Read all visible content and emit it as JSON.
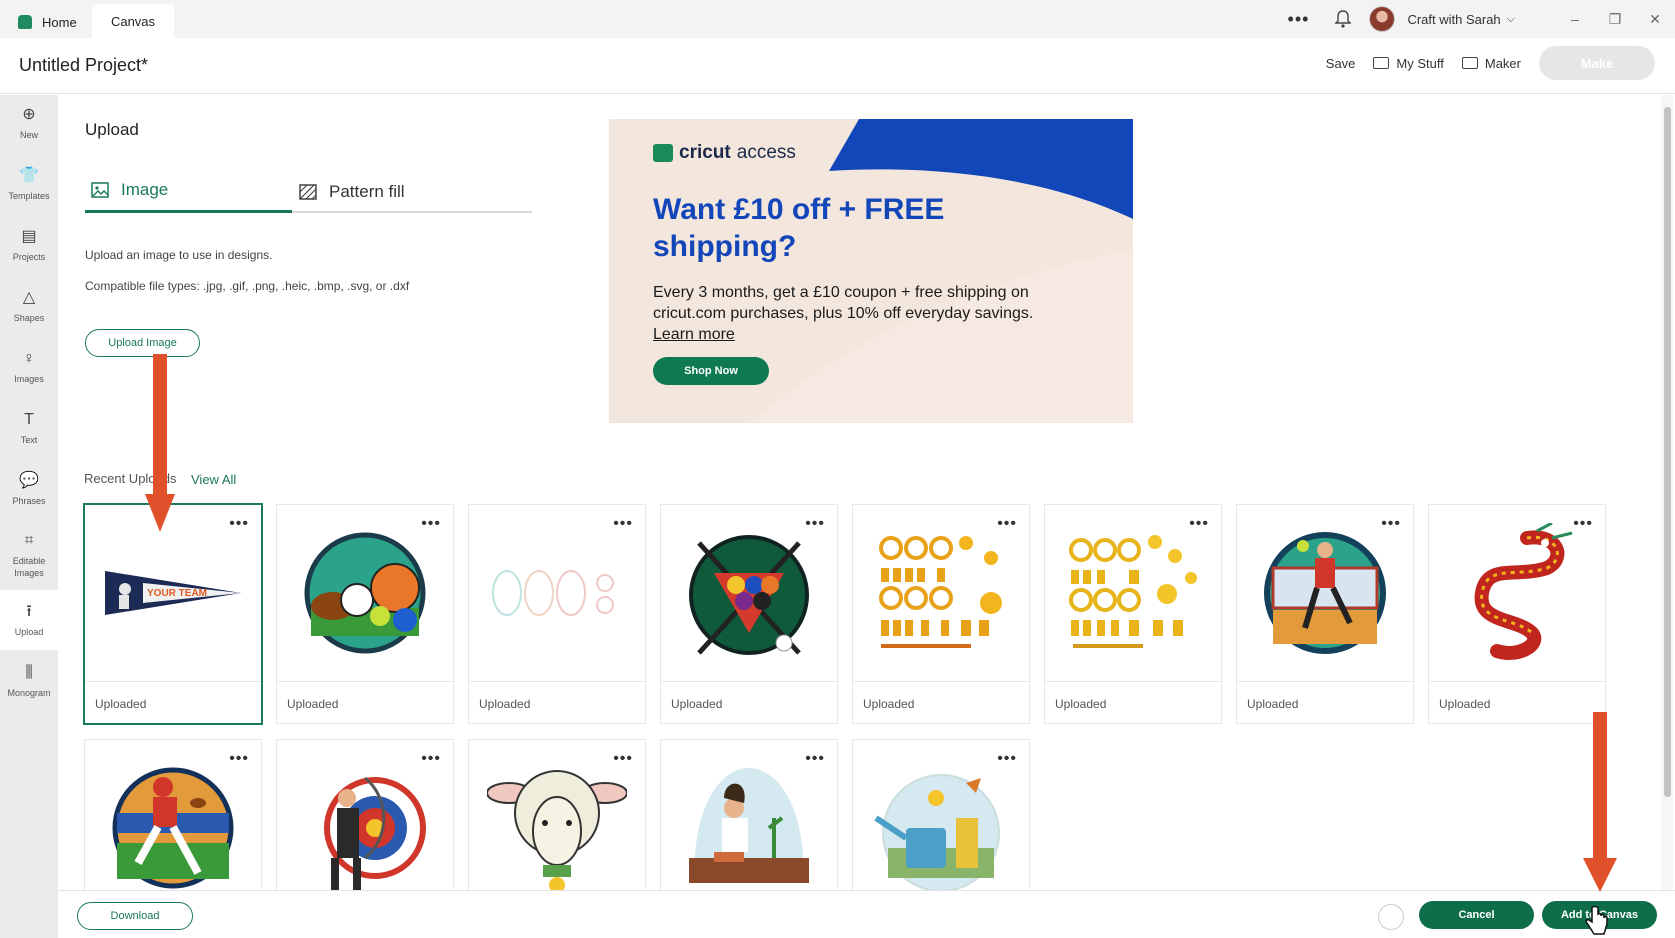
{
  "titlebar": {
    "home_tab": "Home",
    "canvas_tab": "Canvas",
    "user_name": "Craft with Sarah"
  },
  "header": {
    "project_title": "Untitled Project*",
    "save": "Save",
    "my_stuff": "My Stuff",
    "maker": "Maker",
    "make": "Make"
  },
  "leftnav": [
    {
      "label": "New",
      "icon": "plus-circle-icon"
    },
    {
      "label": "Templates",
      "icon": "shirt-icon"
    },
    {
      "label": "Projects",
      "icon": "clipboard-icon"
    },
    {
      "label": "Shapes",
      "icon": "shapes-icon"
    },
    {
      "label": "Images",
      "icon": "lightbulb-icon"
    },
    {
      "label": "Text",
      "icon": "text-icon"
    },
    {
      "label": "Phrases",
      "icon": "speech-bubble-icon"
    },
    {
      "label": "Editable Images",
      "icon": "crop-icon"
    },
    {
      "label": "Upload",
      "icon": "upload-icon"
    },
    {
      "label": "Monogram",
      "icon": "monogram-icon"
    }
  ],
  "upload_panel": {
    "title": "Upload",
    "tab_image": "Image",
    "tab_pattern": "Pattern fill",
    "description": "Upload an image to use in designs.",
    "file_types": "Compatible file types: .jpg, .gif, .png, .heic, .bmp, .svg, or .dxf",
    "upload_button": "Upload Image"
  },
  "ad": {
    "logo_bold": "cricut",
    "logo_light": "access",
    "headline": "Want £10 off + FREE shipping?",
    "body": "Every 3 months, get a £10 coupon + free shipping on cricut.com purchases, plus 10% off everyday savings.",
    "learn_more": "Learn more",
    "shop_now": "Shop Now",
    "colors": {
      "blue": "#1346b8",
      "green": "#0f7a52",
      "bg": "#f3e6dc"
    }
  },
  "recent": {
    "label": "Recent Uploads",
    "view_all": "View All",
    "items": [
      {
        "caption": "Uploaded",
        "icon": "pennant-your-team-icon",
        "pennant_text": "YOUR TEAM"
      },
      {
        "caption": "Uploaded",
        "icon": "sports-balls-icon"
      },
      {
        "caption": "Uploaded",
        "icon": "faint-ornament-outlines-icon"
      },
      {
        "caption": "Uploaded",
        "icon": "billiards-icon"
      },
      {
        "caption": "Uploaded",
        "icon": "gold-ornaments-icon"
      },
      {
        "caption": "Uploaded",
        "icon": "gold-ornaments-2-icon"
      },
      {
        "caption": "Uploaded",
        "icon": "handball-player-icon"
      },
      {
        "caption": "Uploaded",
        "icon": "chinese-dragon-icon"
      },
      {
        "caption": "",
        "icon": "football-player-icon"
      },
      {
        "caption": "",
        "icon": "archer-icon"
      },
      {
        "caption": "",
        "icon": "sheep-icon"
      },
      {
        "caption": "",
        "icon": "gardener-icon"
      },
      {
        "caption": "",
        "icon": "watering-can-icon"
      }
    ]
  },
  "footer": {
    "download": "Download",
    "cancel": "Cancel",
    "add_to_canvas": "Add to Canvas"
  }
}
